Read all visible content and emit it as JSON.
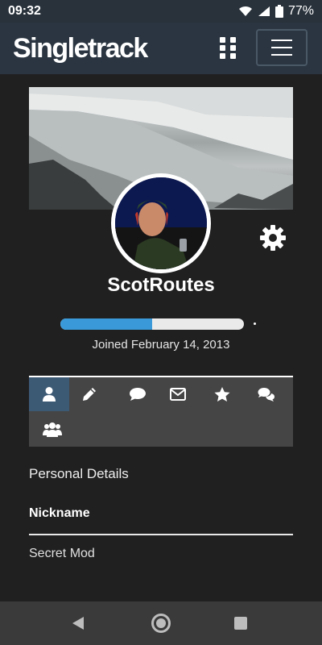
{
  "status_bar": {
    "time": "09:32",
    "battery": "77%"
  },
  "header": {
    "logo": "Singletrack"
  },
  "profile": {
    "username": "ScotRoutes",
    "joined": "Joined February 14, 2013",
    "progress_fraction": 0.5
  },
  "tabs": [
    {
      "name": "profile",
      "icon": "user-icon",
      "active": true
    },
    {
      "name": "posts",
      "icon": "pencil-icon",
      "active": false
    },
    {
      "name": "comments",
      "icon": "comment-icon",
      "active": false
    },
    {
      "name": "messages",
      "icon": "envelope-icon",
      "active": false
    },
    {
      "name": "favorites",
      "icon": "star-icon",
      "active": false
    },
    {
      "name": "discussions",
      "icon": "comments-icon",
      "active": false
    },
    {
      "name": "groups",
      "icon": "users-icon",
      "active": false
    }
  ],
  "personal_details": {
    "title": "Personal Details",
    "nickname_label": "Nickname",
    "nickname_value": "Secret Mod"
  },
  "colors": {
    "header_bg": "#2a3541",
    "accent": "#3a9ad9",
    "active_tab": "#3d5a75",
    "page_bg": "#202020"
  }
}
